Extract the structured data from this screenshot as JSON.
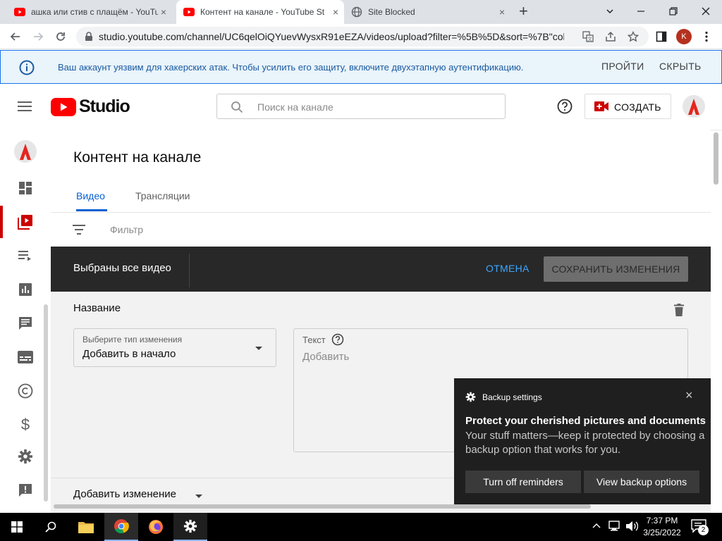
{
  "browser": {
    "tabs": [
      {
        "title": "ашка или стив с плащём - YouTu",
        "close": "×"
      },
      {
        "title": "Контент на канале - YouTube St",
        "close": "×"
      },
      {
        "title": "Site Blocked",
        "close": "×"
      }
    ],
    "new_tab": "+",
    "url": "studio.youtube.com/channel/UC6qelOiQYuevWysxR91eEZA/videos/upload?filter=%5B%5D&sort=%7B\"col...",
    "profile_initial": "K"
  },
  "banner": {
    "text": "Ваш аккаунт уязвим для хакерских атак. Чтобы усилить его защиту, включите двухэтапную аутентификацию.",
    "action": "ПРОЙТИ",
    "dismiss": "СКРЫТЬ"
  },
  "header": {
    "logo_text": "Studio",
    "search_placeholder": "Поиск на канале",
    "create_label": "СОЗДАТЬ"
  },
  "main": {
    "title": "Контент на канале",
    "tabs": [
      "Видео",
      "Трансляции"
    ],
    "filter_label": "Фильтр",
    "bulk_bar": {
      "selected": "Выбраны все видео",
      "cancel": "ОТМЕНА",
      "save": "СОХРАНИТЬ ИЗМЕНЕНИЯ"
    },
    "edit": {
      "field_label": "Название",
      "select_label": "Выберите тип изменения",
      "select_value": "Добавить в начало",
      "text_label": "Текст",
      "text_placeholder": "Добавить",
      "add_change": "Добавить изменение"
    }
  },
  "notification": {
    "app": "Backup settings",
    "title": "Protect your cherished pictures and documents",
    "body": "Your stuff matters—keep it protected by choosing a backup option that works for you.",
    "btn_off": "Turn off reminders",
    "btn_view": "View backup options",
    "close": "×"
  },
  "taskbar": {
    "time": "7:37 PM",
    "date": "3/25/2022",
    "notif_count": "2"
  },
  "colors": {
    "yt_red": "#ff0000",
    "link_blue": "#065fd4",
    "cancel_blue": "#3ea6ff",
    "dark_bar": "#282828"
  }
}
